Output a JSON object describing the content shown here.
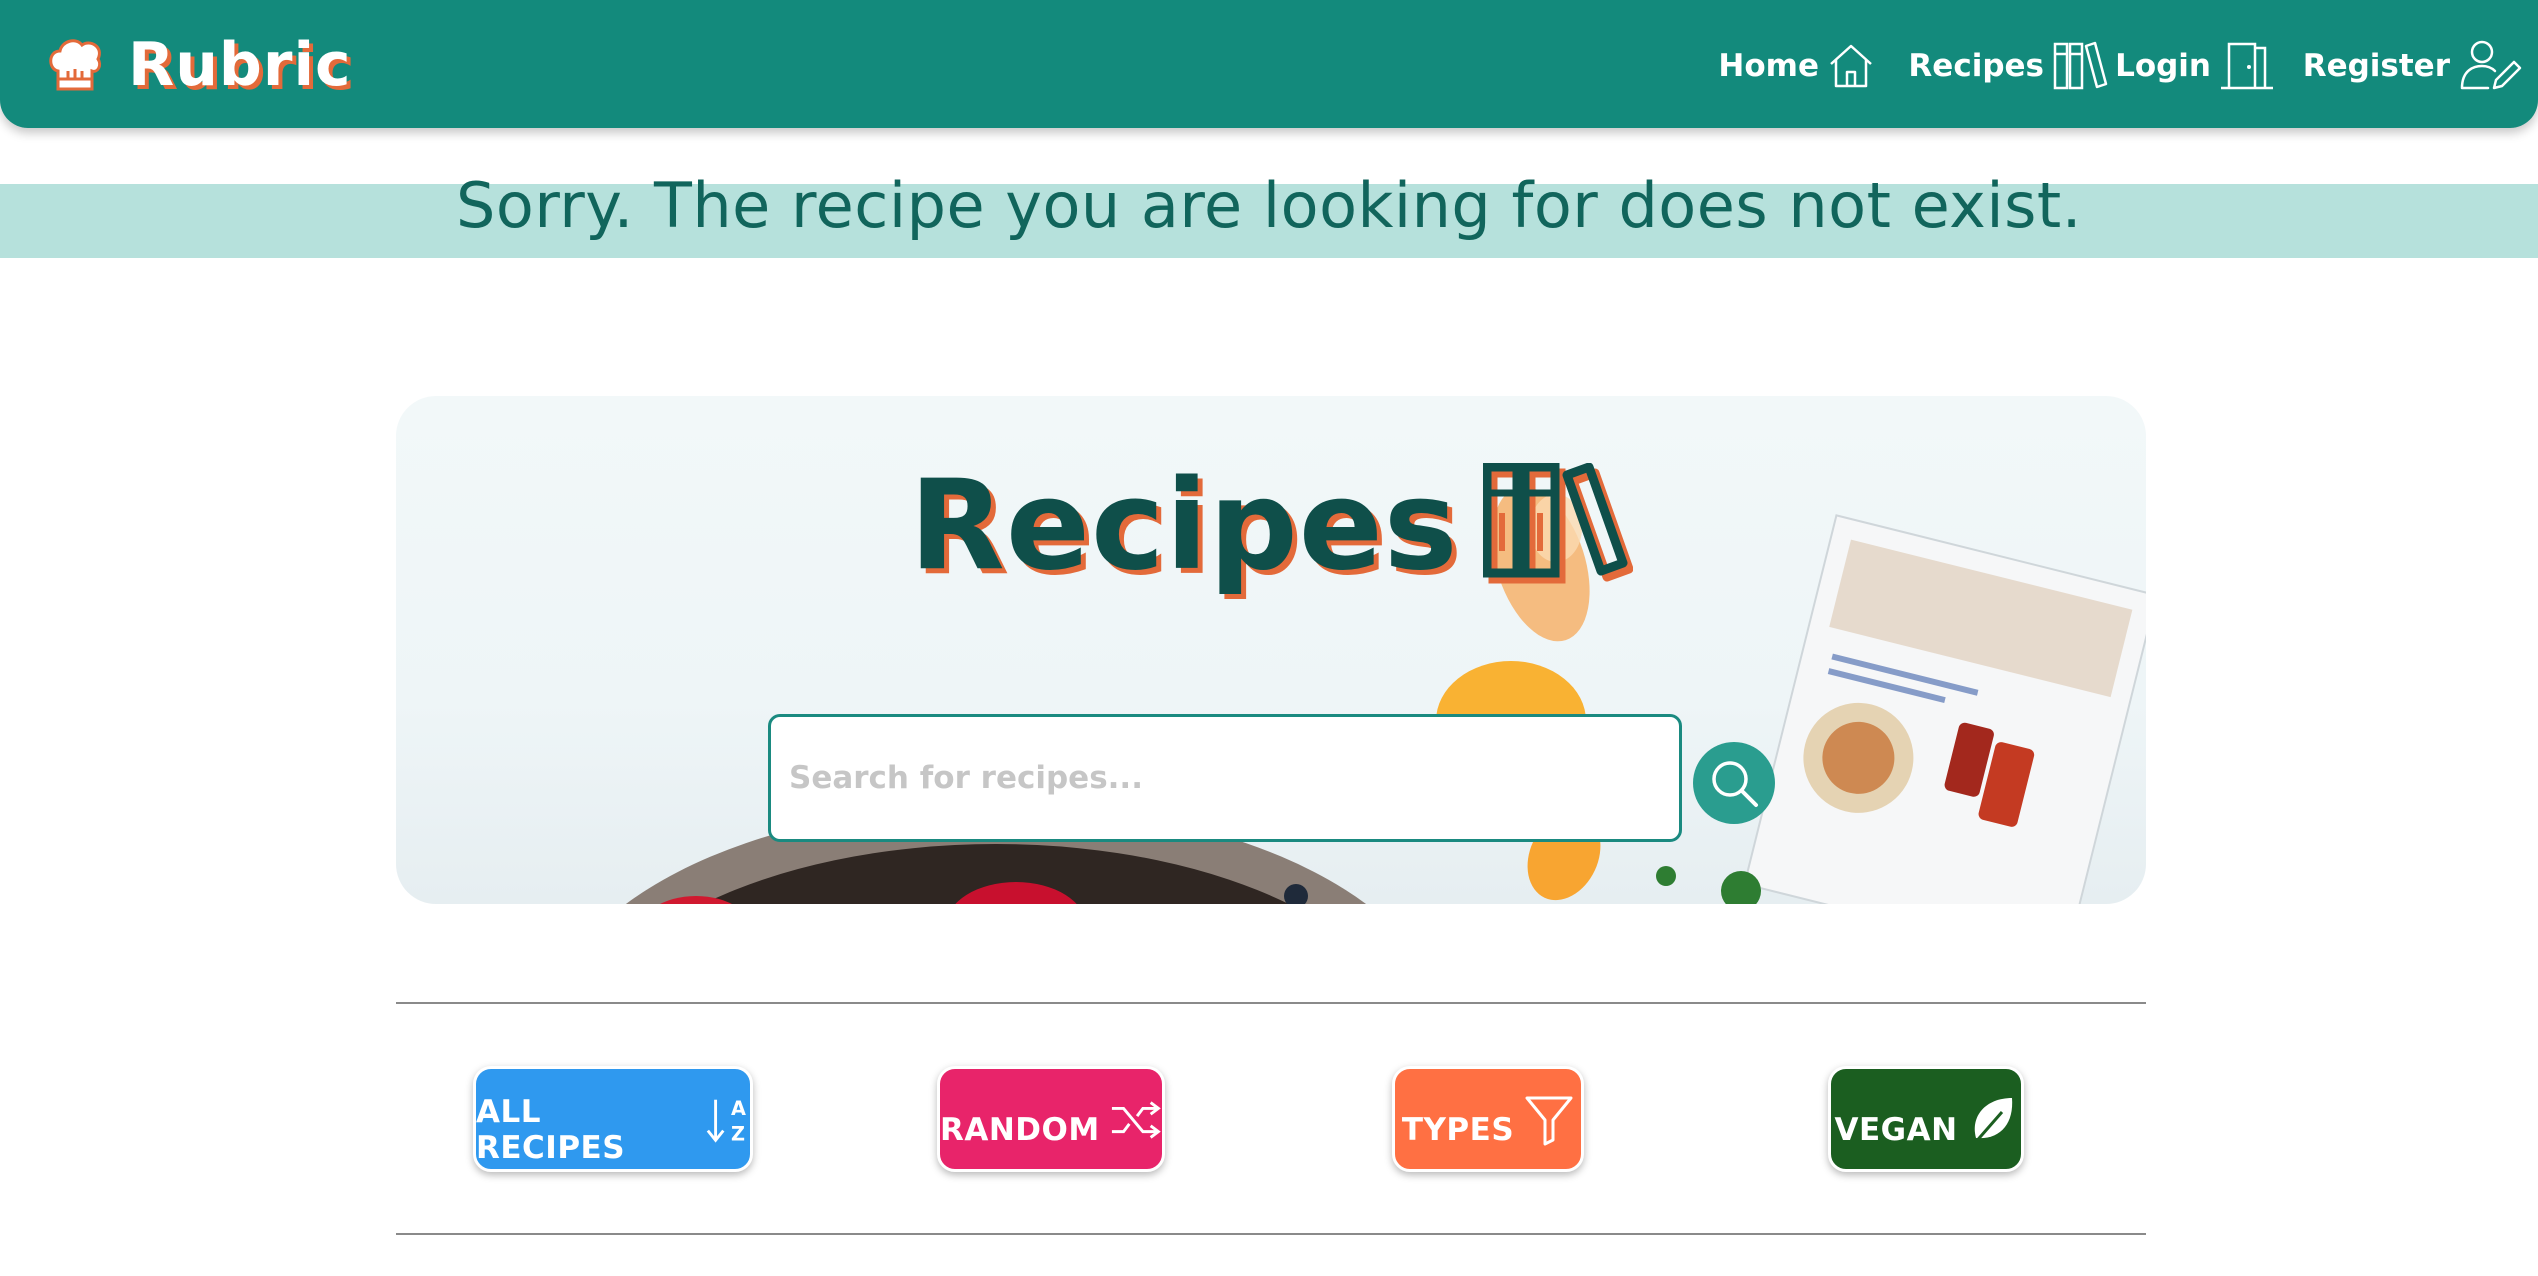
{
  "brand": {
    "name": "Rubric",
    "icon": "chef-hat-icon"
  },
  "nav": {
    "items": [
      {
        "label": "Home",
        "icon": "house-icon"
      },
      {
        "label": "Recipes",
        "icon": "books-icon"
      },
      {
        "label": "Login",
        "icon": "door-icon"
      },
      {
        "label": "Register",
        "icon": "user-edit-icon"
      }
    ]
  },
  "error": {
    "message": "Sorry. The recipe you are looking for does not exist."
  },
  "hero": {
    "title": "Recipes",
    "title_icon": "books-icon",
    "search": {
      "placeholder": "Search for recipes...",
      "value": "",
      "button_icon": "search-icon"
    }
  },
  "categories": [
    {
      "label": "ALL RECIPES",
      "icon": "sort-a-z-icon",
      "color": "#2f99ef"
    },
    {
      "label": "RANDOM",
      "icon": "shuffle-icon",
      "color": "#e8246a"
    },
    {
      "label": "TYPES",
      "icon": "filter-icon",
      "color": "#ff7043"
    },
    {
      "label": "VEGAN",
      "icon": "leaf-icon",
      "color": "#1b5e20"
    }
  ],
  "colors": {
    "navbar": "#138a7c",
    "banner": "#b6e1dc",
    "banner_text": "#11655c",
    "title_text": "#0f4f4a",
    "accent_shadow": "#e36a3a"
  }
}
